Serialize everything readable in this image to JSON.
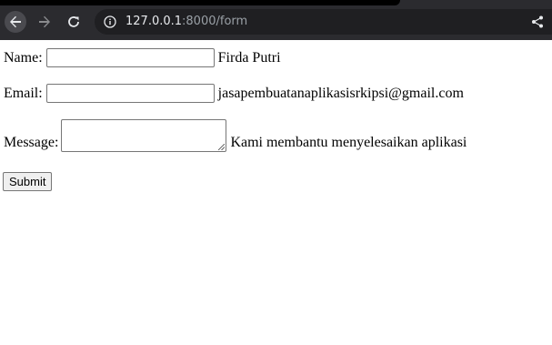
{
  "browser": {
    "url_host": "127.0.0.1",
    "url_rest": ":8000/form",
    "icons": [
      "back-arrow-icon",
      "forward-arrow-icon",
      "reload-icon",
      "info-icon",
      "share-icon"
    ]
  },
  "form": {
    "name": {
      "label": "Name:",
      "value": "",
      "display_text": "Firda Putri"
    },
    "email": {
      "label": "Email:",
      "value": "",
      "display_text": "jasapembuatanaplikasisrkipsi@gmail.com"
    },
    "message": {
      "label": "Message:",
      "value": "",
      "display_text": "Kami membantu menyelesaikan aplikasi"
    },
    "submit_label": "Submit"
  }
}
